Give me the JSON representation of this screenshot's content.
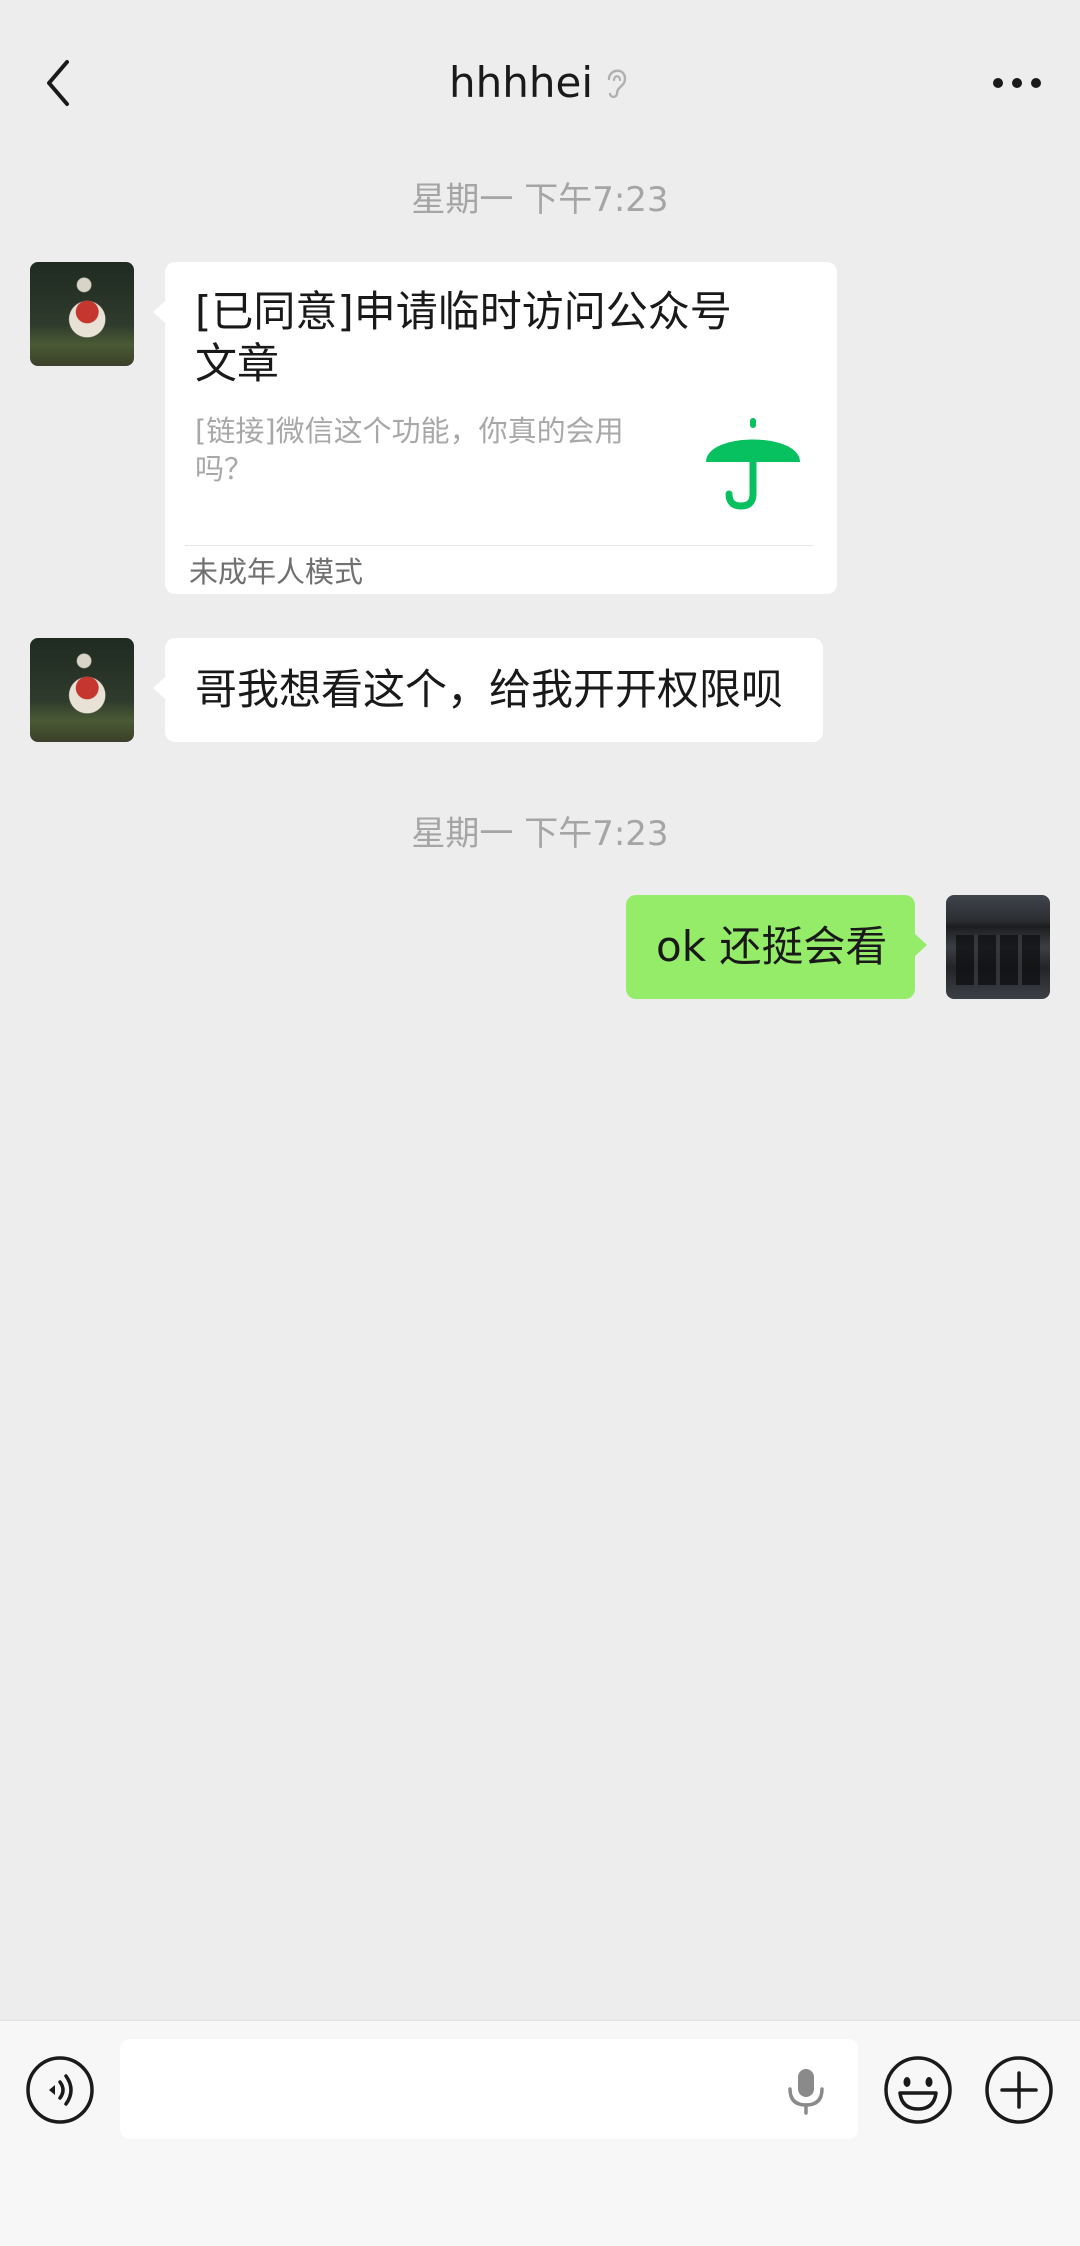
{
  "header": {
    "title": "hhhhei"
  },
  "messages": {
    "ts1": "星期一 下午7:23",
    "card": {
      "title": "[已同意]申请临时访问公众号文章",
      "desc": "[链接]微信这个功能，你真的会用吗？",
      "source": "未成年人模式",
      "thumb_icon": "umbrella-icon",
      "thumb_color": "#07c160"
    },
    "msg2": "哥我想看这个，给我开开权限呗",
    "ts2": "星期一 下午7:23",
    "msg3": "ok 还挺会看"
  },
  "input": {
    "placeholder": ""
  },
  "colors": {
    "background": "#ededed",
    "self_bubble": "#95ec69",
    "other_bubble": "#ffffff",
    "timestamp": "#a5a5a5"
  }
}
